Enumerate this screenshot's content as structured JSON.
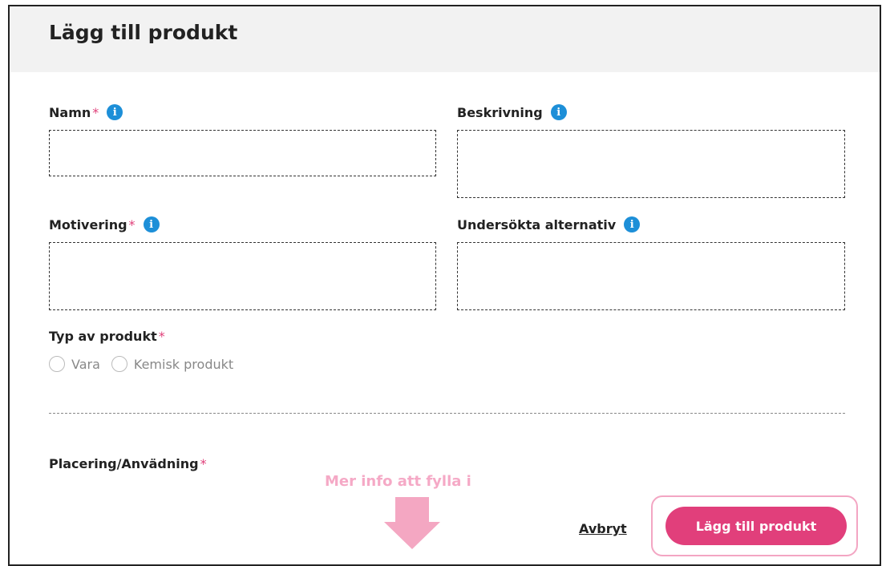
{
  "dialog": {
    "title": "Lägg till produkt"
  },
  "fields": {
    "namn": {
      "label": "Namn",
      "required_mark": "*",
      "value": ""
    },
    "beskrivning": {
      "label": "Beskrivning",
      "value": ""
    },
    "motivering": {
      "label": "Motivering",
      "required_mark": "*",
      "value": ""
    },
    "undersokta": {
      "label": "Undersökta alternativ",
      "value": ""
    }
  },
  "product_type": {
    "label": "Typ av produkt",
    "required_mark": "*",
    "options": [
      "Vara",
      "Kemisk produkt"
    ],
    "selected": null
  },
  "placement": {
    "label": "Placering/Anvädning",
    "required_mark": "*"
  },
  "annotation": {
    "text": "Mer info att fylla i"
  },
  "actions": {
    "cancel_label": "Avbryt",
    "submit_label": "Lägg till produkt"
  },
  "colors": {
    "accent": "#e13f7b",
    "info": "#1d8fd8",
    "annotation": "#f4a7c2",
    "header_bg": "#f2f2f2"
  },
  "icons": {
    "info": "info-icon",
    "arrow": "arrow-down-icon"
  }
}
